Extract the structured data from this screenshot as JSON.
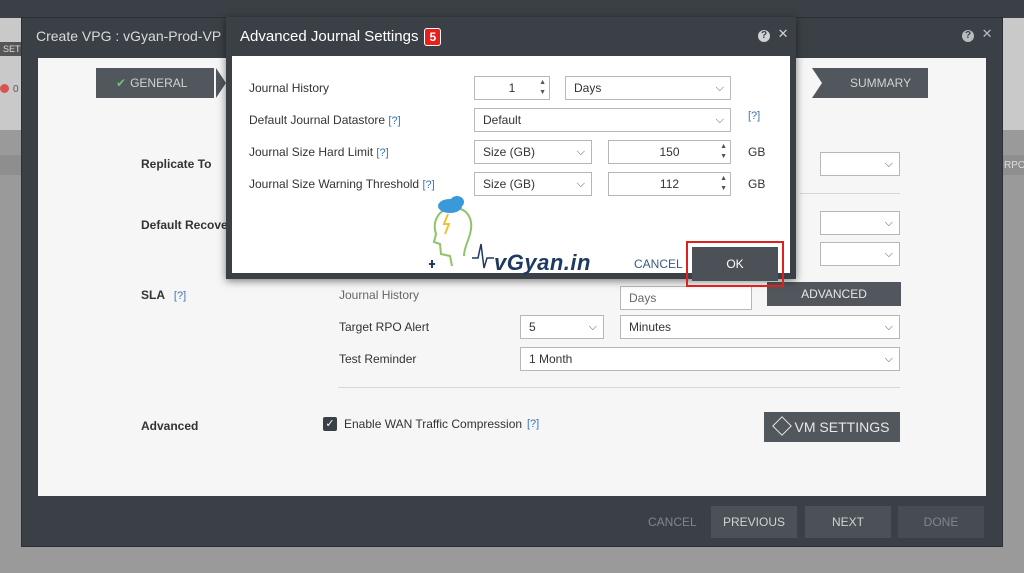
{
  "background": {
    "left_text": "SETU",
    "counter_text": "0",
    "right_text": "RPO"
  },
  "wizard": {
    "title": "Create VPG : vGyan-Prod-VP",
    "help_label": "?",
    "close_label": "✕",
    "steps": [
      {
        "label": "GENERAL",
        "done": true
      },
      {
        "label": "SUMMARY",
        "done": false
      }
    ],
    "sections": {
      "replicate_to": "Replicate To",
      "default_recovery": "Default Recove",
      "sla": "SLA",
      "sla_help": "[?]",
      "advanced": "Advanced"
    },
    "sla_rows": {
      "journal_history_label": "Journal History",
      "journal_unit": "Days",
      "advanced_button": "ADVANCED",
      "target_rpo_label": "Target RPO Alert",
      "target_rpo_value": "5",
      "target_rpo_unit": "Minutes",
      "test_reminder_label": "Test Reminder",
      "test_reminder_value": "1 Month"
    },
    "advanced_opts": {
      "wan_compression_label": "Enable WAN Traffic Compression",
      "wan_compression_checked": true,
      "wan_help": "[?]",
      "vm_settings_button": "VM SETTINGS"
    },
    "footer": {
      "cancel": "CANCEL",
      "previous": "PREVIOUS",
      "next": "NEXT",
      "done": "DONE"
    }
  },
  "modal": {
    "title": "Advanced Journal Settings",
    "step_badge": "5",
    "help_label": "?",
    "close_label": "✕",
    "rows": {
      "journal_history": {
        "label": "Journal History",
        "value": "1",
        "unit": "Days"
      },
      "default_datastore": {
        "label": "Default Journal Datastore",
        "help": "[?]",
        "value": "Default",
        "side_help": "[?]"
      },
      "hard_limit": {
        "label": "Journal Size Hard Limit",
        "help": "[?]",
        "mode": "Size (GB)",
        "value": "150",
        "unit": "GB"
      },
      "warning_threshold": {
        "label": "Journal Size Warning Threshold",
        "help": "[?]",
        "mode": "Size (GB)",
        "value": "112",
        "unit": "GB"
      }
    },
    "cancel_label": "CANCEL",
    "ok_label": "OK",
    "watermark": "vGyan.in"
  },
  "colors": {
    "dark_chrome": "#3b4046",
    "badge_red": "#e8201c",
    "link_blue": "#3a74b7"
  }
}
